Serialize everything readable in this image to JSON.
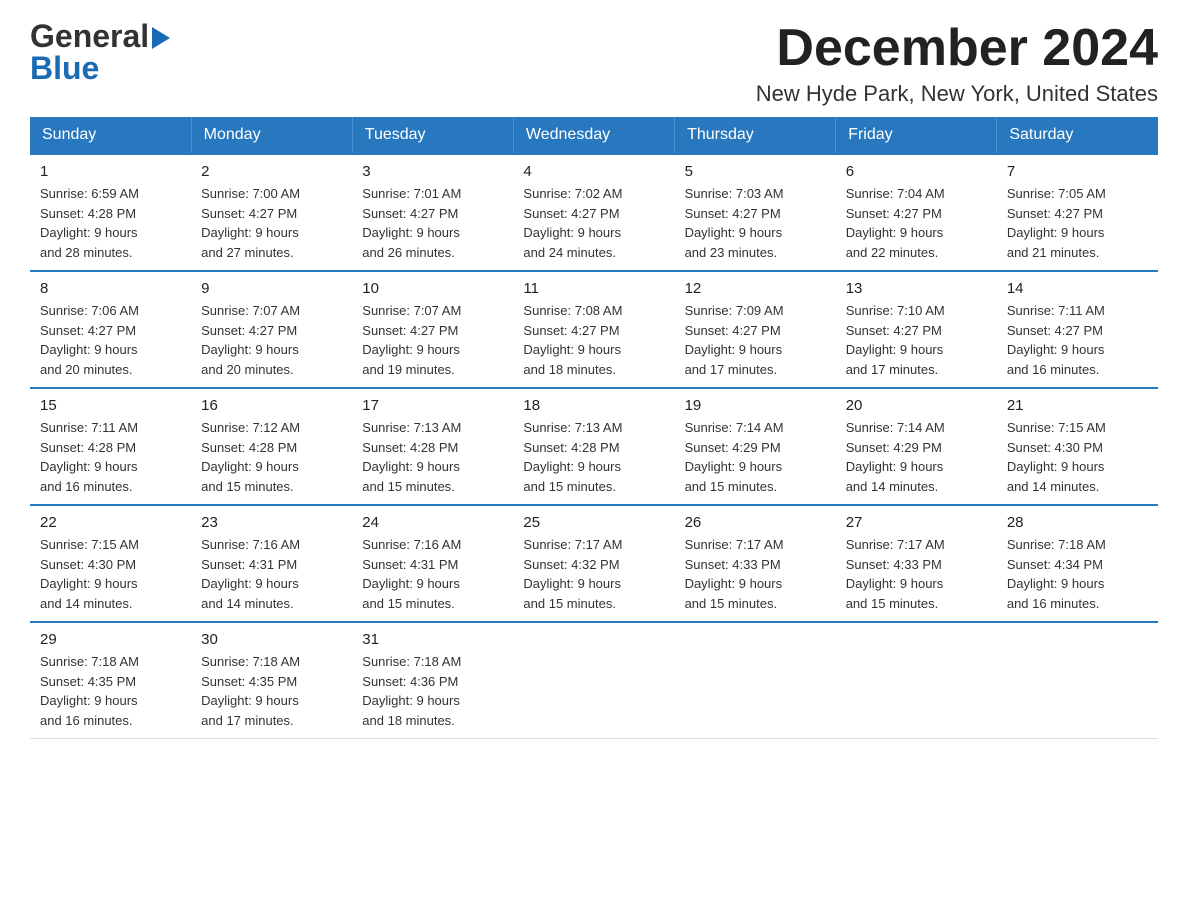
{
  "logo": {
    "general": "General",
    "arrow": "▶",
    "blue": "Blue"
  },
  "title": "December 2024",
  "subtitle": "New Hyde Park, New York, United States",
  "days": [
    "Sunday",
    "Monday",
    "Tuesday",
    "Wednesday",
    "Thursday",
    "Friday",
    "Saturday"
  ],
  "weeks": [
    [
      {
        "day": "1",
        "sunrise": "Sunrise: 6:59 AM",
        "sunset": "Sunset: 4:28 PM",
        "daylight": "Daylight: 9 hours",
        "daylight2": "and 28 minutes."
      },
      {
        "day": "2",
        "sunrise": "Sunrise: 7:00 AM",
        "sunset": "Sunset: 4:27 PM",
        "daylight": "Daylight: 9 hours",
        "daylight2": "and 27 minutes."
      },
      {
        "day": "3",
        "sunrise": "Sunrise: 7:01 AM",
        "sunset": "Sunset: 4:27 PM",
        "daylight": "Daylight: 9 hours",
        "daylight2": "and 26 minutes."
      },
      {
        "day": "4",
        "sunrise": "Sunrise: 7:02 AM",
        "sunset": "Sunset: 4:27 PM",
        "daylight": "Daylight: 9 hours",
        "daylight2": "and 24 minutes."
      },
      {
        "day": "5",
        "sunrise": "Sunrise: 7:03 AM",
        "sunset": "Sunset: 4:27 PM",
        "daylight": "Daylight: 9 hours",
        "daylight2": "and 23 minutes."
      },
      {
        "day": "6",
        "sunrise": "Sunrise: 7:04 AM",
        "sunset": "Sunset: 4:27 PM",
        "daylight": "Daylight: 9 hours",
        "daylight2": "and 22 minutes."
      },
      {
        "day": "7",
        "sunrise": "Sunrise: 7:05 AM",
        "sunset": "Sunset: 4:27 PM",
        "daylight": "Daylight: 9 hours",
        "daylight2": "and 21 minutes."
      }
    ],
    [
      {
        "day": "8",
        "sunrise": "Sunrise: 7:06 AM",
        "sunset": "Sunset: 4:27 PM",
        "daylight": "Daylight: 9 hours",
        "daylight2": "and 20 minutes."
      },
      {
        "day": "9",
        "sunrise": "Sunrise: 7:07 AM",
        "sunset": "Sunset: 4:27 PM",
        "daylight": "Daylight: 9 hours",
        "daylight2": "and 20 minutes."
      },
      {
        "day": "10",
        "sunrise": "Sunrise: 7:07 AM",
        "sunset": "Sunset: 4:27 PM",
        "daylight": "Daylight: 9 hours",
        "daylight2": "and 19 minutes."
      },
      {
        "day": "11",
        "sunrise": "Sunrise: 7:08 AM",
        "sunset": "Sunset: 4:27 PM",
        "daylight": "Daylight: 9 hours",
        "daylight2": "and 18 minutes."
      },
      {
        "day": "12",
        "sunrise": "Sunrise: 7:09 AM",
        "sunset": "Sunset: 4:27 PM",
        "daylight": "Daylight: 9 hours",
        "daylight2": "and 17 minutes."
      },
      {
        "day": "13",
        "sunrise": "Sunrise: 7:10 AM",
        "sunset": "Sunset: 4:27 PM",
        "daylight": "Daylight: 9 hours",
        "daylight2": "and 17 minutes."
      },
      {
        "day": "14",
        "sunrise": "Sunrise: 7:11 AM",
        "sunset": "Sunset: 4:27 PM",
        "daylight": "Daylight: 9 hours",
        "daylight2": "and 16 minutes."
      }
    ],
    [
      {
        "day": "15",
        "sunrise": "Sunrise: 7:11 AM",
        "sunset": "Sunset: 4:28 PM",
        "daylight": "Daylight: 9 hours",
        "daylight2": "and 16 minutes."
      },
      {
        "day": "16",
        "sunrise": "Sunrise: 7:12 AM",
        "sunset": "Sunset: 4:28 PM",
        "daylight": "Daylight: 9 hours",
        "daylight2": "and 15 minutes."
      },
      {
        "day": "17",
        "sunrise": "Sunrise: 7:13 AM",
        "sunset": "Sunset: 4:28 PM",
        "daylight": "Daylight: 9 hours",
        "daylight2": "and 15 minutes."
      },
      {
        "day": "18",
        "sunrise": "Sunrise: 7:13 AM",
        "sunset": "Sunset: 4:28 PM",
        "daylight": "Daylight: 9 hours",
        "daylight2": "and 15 minutes."
      },
      {
        "day": "19",
        "sunrise": "Sunrise: 7:14 AM",
        "sunset": "Sunset: 4:29 PM",
        "daylight": "Daylight: 9 hours",
        "daylight2": "and 15 minutes."
      },
      {
        "day": "20",
        "sunrise": "Sunrise: 7:14 AM",
        "sunset": "Sunset: 4:29 PM",
        "daylight": "Daylight: 9 hours",
        "daylight2": "and 14 minutes."
      },
      {
        "day": "21",
        "sunrise": "Sunrise: 7:15 AM",
        "sunset": "Sunset: 4:30 PM",
        "daylight": "Daylight: 9 hours",
        "daylight2": "and 14 minutes."
      }
    ],
    [
      {
        "day": "22",
        "sunrise": "Sunrise: 7:15 AM",
        "sunset": "Sunset: 4:30 PM",
        "daylight": "Daylight: 9 hours",
        "daylight2": "and 14 minutes."
      },
      {
        "day": "23",
        "sunrise": "Sunrise: 7:16 AM",
        "sunset": "Sunset: 4:31 PM",
        "daylight": "Daylight: 9 hours",
        "daylight2": "and 14 minutes."
      },
      {
        "day": "24",
        "sunrise": "Sunrise: 7:16 AM",
        "sunset": "Sunset: 4:31 PM",
        "daylight": "Daylight: 9 hours",
        "daylight2": "and 15 minutes."
      },
      {
        "day": "25",
        "sunrise": "Sunrise: 7:17 AM",
        "sunset": "Sunset: 4:32 PM",
        "daylight": "Daylight: 9 hours",
        "daylight2": "and 15 minutes."
      },
      {
        "day": "26",
        "sunrise": "Sunrise: 7:17 AM",
        "sunset": "Sunset: 4:33 PM",
        "daylight": "Daylight: 9 hours",
        "daylight2": "and 15 minutes."
      },
      {
        "day": "27",
        "sunrise": "Sunrise: 7:17 AM",
        "sunset": "Sunset: 4:33 PM",
        "daylight": "Daylight: 9 hours",
        "daylight2": "and 15 minutes."
      },
      {
        "day": "28",
        "sunrise": "Sunrise: 7:18 AM",
        "sunset": "Sunset: 4:34 PM",
        "daylight": "Daylight: 9 hours",
        "daylight2": "and 16 minutes."
      }
    ],
    [
      {
        "day": "29",
        "sunrise": "Sunrise: 7:18 AM",
        "sunset": "Sunset: 4:35 PM",
        "daylight": "Daylight: 9 hours",
        "daylight2": "and 16 minutes."
      },
      {
        "day": "30",
        "sunrise": "Sunrise: 7:18 AM",
        "sunset": "Sunset: 4:35 PM",
        "daylight": "Daylight: 9 hours",
        "daylight2": "and 17 minutes."
      },
      {
        "day": "31",
        "sunrise": "Sunrise: 7:18 AM",
        "sunset": "Sunset: 4:36 PM",
        "daylight": "Daylight: 9 hours",
        "daylight2": "and 18 minutes."
      },
      {
        "day": "",
        "sunrise": "",
        "sunset": "",
        "daylight": "",
        "daylight2": ""
      },
      {
        "day": "",
        "sunrise": "",
        "sunset": "",
        "daylight": "",
        "daylight2": ""
      },
      {
        "day": "",
        "sunrise": "",
        "sunset": "",
        "daylight": "",
        "daylight2": ""
      },
      {
        "day": "",
        "sunrise": "",
        "sunset": "",
        "daylight": "",
        "daylight2": ""
      }
    ]
  ]
}
